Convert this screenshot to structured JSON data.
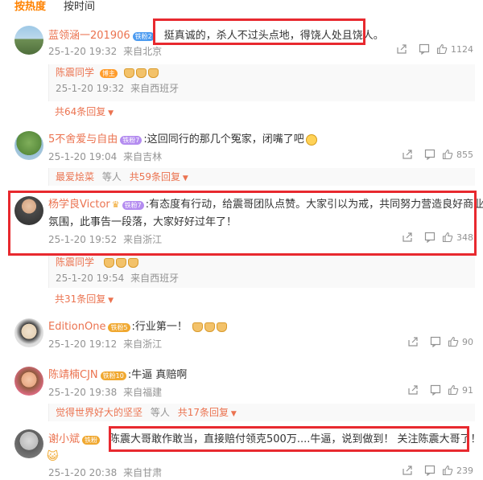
{
  "tabs": [
    "按热度",
    "按时间"
  ],
  "comments": [
    {
      "author": "蓝领涵一201906",
      "badge": "铁粉2",
      "text": "挺真诚的，杀人不过头点地，得饶人处且饶人。",
      "time": "25-1-20 19:32",
      "location": "来自北京",
      "likes": "1124",
      "reply": {
        "author": "陈震同学",
        "badge": "博主",
        "time": "25-1-20 19:32",
        "location": "来自西班牙"
      },
      "more": "共64条回复"
    },
    {
      "author": "5不舍爱与自由",
      "badge": "铁粉7",
      "text": ":这回同行的那几个冤家，闭嘴了吧",
      "time": "25-1-20 19:04",
      "location": "来自吉林",
      "likes": "855",
      "reply_summary": {
        "name": "最爱烩菜",
        "others": "等人",
        "more": "共59条回复"
      }
    },
    {
      "author": "杨学良Victor",
      "badge": "铁粉7",
      "text_line1": ":有态度有行动，给震哥团队点赞。大家引以为戒，共同努力营造良好商业",
      "text_line2": "氛围，此事告一段落，大家好好过年了！",
      "time": "25-1-20 19:52",
      "location": "来自浙江",
      "likes": "348",
      "reply": {
        "author": "陈震同学",
        "time": "25-1-20 19:54",
        "location": "来自西班牙"
      },
      "more": "共31条回复"
    },
    {
      "author": "EditionOne",
      "badge": "铁粉5",
      "text": ":行业第一！",
      "time": "25-1-20 19:12",
      "location": "来自浙江",
      "likes": "90"
    },
    {
      "author": "陈靖楠CJN",
      "badge": "铁粉10",
      "text": ":牛逼 真赔啊",
      "time": "25-1-20 19:38",
      "location": "来自福建",
      "likes": "91",
      "reply_summary": {
        "name": "觉得世界好大的坚坚",
        "others": "等人",
        "more": "共17条回复"
      }
    },
    {
      "author": "谢小斌",
      "badge": "铁粉",
      "text": "陈震大哥敢作敢当，直接赔付领克500万....牛逼，说到做到！ 关注陈震大哥了！",
      "time": "25-1-20 20:38",
      "location": "来自甘肃",
      "likes": "239"
    }
  ],
  "colors": {
    "accent": "#ff8200",
    "author": "#eb7350",
    "meta": "#939393",
    "highlight_box": "#e8292f"
  }
}
